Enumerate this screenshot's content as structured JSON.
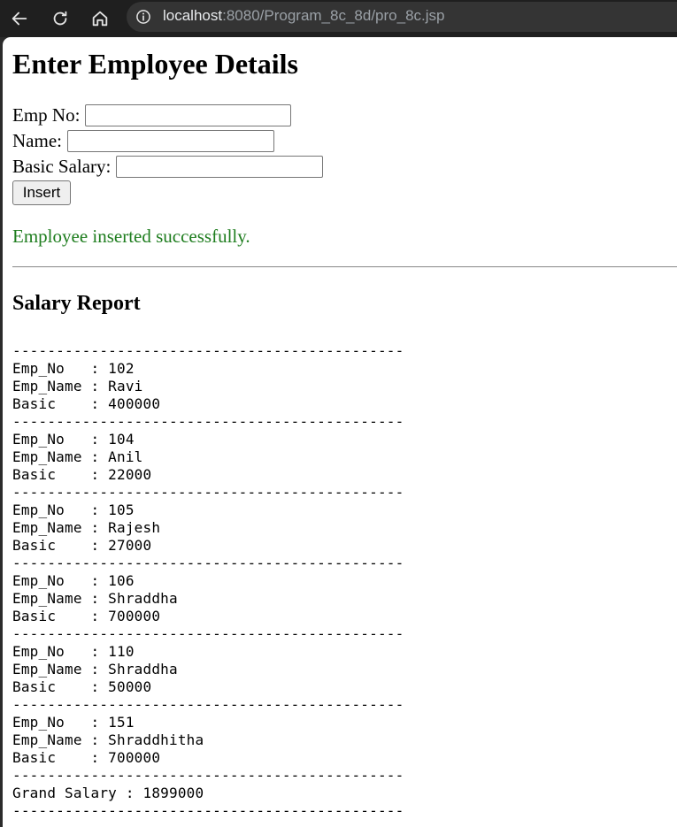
{
  "browser": {
    "url_host": "localhost",
    "url_path": ":8080/Program_8c_8d/pro_8c.jsp",
    "icons": [
      "back-arrow-icon",
      "reload-icon",
      "home-icon",
      "site-info-icon"
    ]
  },
  "page": {
    "heading": "Enter Employee Details",
    "form": {
      "empno_label": "Emp No:",
      "empno_value": "",
      "name_label": "Name:",
      "name_value": "",
      "salary_label": "Basic Salary:",
      "salary_value": "",
      "insert_label": "Insert"
    },
    "message": "Employee inserted successfully.",
    "message_color": "#1e7d1e",
    "report_title": "Salary Report",
    "separator": "---------------------------------------------",
    "field_labels": {
      "emp_no": "Emp_No   : ",
      "emp_name": "Emp_Name : ",
      "basic": "Basic    : "
    },
    "employees": [
      {
        "emp_no": "102",
        "emp_name": "Ravi",
        "basic": "400000"
      },
      {
        "emp_no": "104",
        "emp_name": "Anil",
        "basic": "22000"
      },
      {
        "emp_no": "105",
        "emp_name": "Rajesh",
        "basic": "27000"
      },
      {
        "emp_no": "106",
        "emp_name": "Shraddha",
        "basic": "700000"
      },
      {
        "emp_no": "110",
        "emp_name": "Shraddha",
        "basic": "50000"
      },
      {
        "emp_no": "151",
        "emp_name": "Shraddhitha",
        "basic": "700000"
      }
    ],
    "grand_label": "Grand Salary : ",
    "grand_total": "1899000"
  }
}
